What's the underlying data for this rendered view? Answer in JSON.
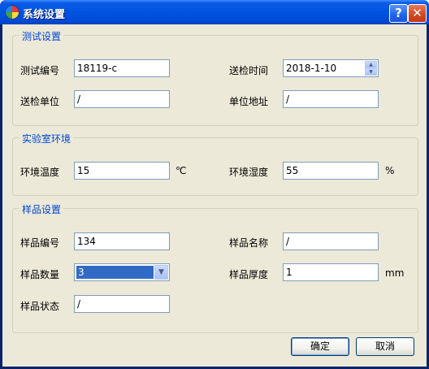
{
  "window": {
    "title": "系统设置",
    "help_label": "?",
    "close_label": "✕"
  },
  "test_settings": {
    "legend": "测试设置",
    "test_no_label": "测试编号",
    "test_no_value": "18119-c",
    "send_time_label": "送检时间",
    "send_time_value": "2018-1-10",
    "send_unit_label": "送检单位",
    "send_unit_value": "/",
    "unit_address_label": "单位地址",
    "unit_address_value": "/"
  },
  "lab_environment": {
    "legend": "实验室环境",
    "temperature_label": "环境温度",
    "temperature_value": "15",
    "temperature_unit": "℃",
    "humidity_label": "环境湿度",
    "humidity_value": "55",
    "humidity_unit": "%"
  },
  "sample_settings": {
    "legend": "样品设置",
    "sample_no_label": "样品编号",
    "sample_no_value": "134",
    "sample_name_label": "样品名称",
    "sample_name_value": "/",
    "sample_count_label": "样品数量",
    "sample_count_value": "3",
    "thickness_label": "样品厚度",
    "thickness_value": "1",
    "thickness_unit": "mm",
    "sample_state_label": "样品状态",
    "sample_state_value": "/"
  },
  "buttons": {
    "ok_label": "确定",
    "cancel_label": "取消"
  },
  "icons": {
    "app": "color-wheel-icon",
    "spin_up": "spin-up-icon",
    "spin_down": "spin-down-icon",
    "dropdown": "chevron-down-icon"
  }
}
